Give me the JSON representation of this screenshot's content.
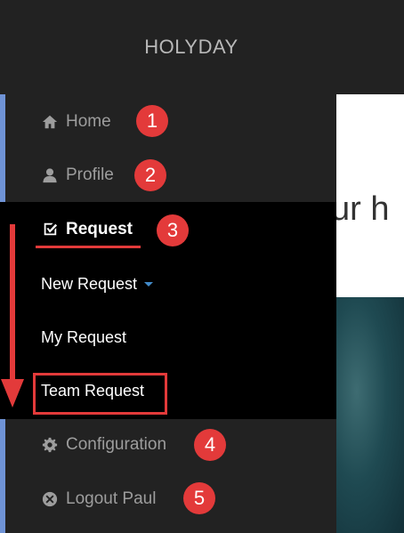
{
  "header": {
    "brand": "HOLYDAY"
  },
  "sidebar": {
    "items": [
      {
        "label": "Home",
        "icon": "home-icon"
      },
      {
        "label": "Profile",
        "icon": "user-icon"
      },
      {
        "label": "Request",
        "icon": "checkbox-icon"
      },
      {
        "label": "Configuration",
        "icon": "gear-icon"
      },
      {
        "label": "Logout Paul",
        "icon": "close-circle-icon"
      }
    ],
    "request_submenu": [
      {
        "label": "New Request"
      },
      {
        "label": "My Request"
      },
      {
        "label": "Team Request"
      }
    ]
  },
  "content": {
    "heading_fragment": "ur h"
  },
  "annotations": {
    "badges": [
      "1",
      "2",
      "3",
      "4",
      "5"
    ],
    "color": "#e33a3a"
  },
  "colors": {
    "navbar_bg": "#222222",
    "submenu_bg": "#000000",
    "sidebar_edge": "#6f93d6",
    "caret": "#428bca"
  }
}
